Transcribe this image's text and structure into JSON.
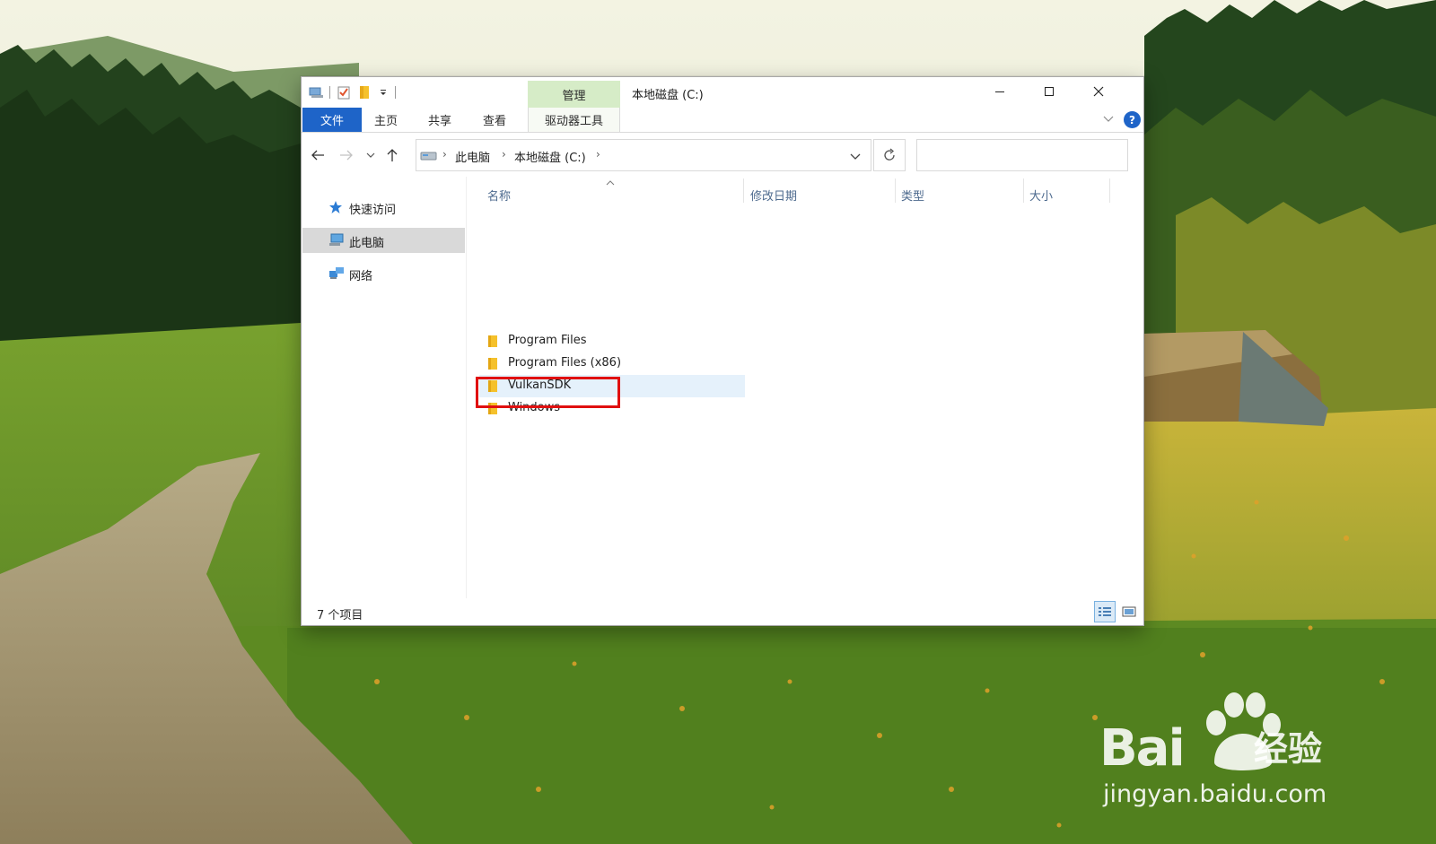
{
  "window": {
    "title": "本地磁盘 (C:)",
    "contextual_tab_group": "管理"
  },
  "ribbon": {
    "tabs": [
      {
        "label": "文件"
      },
      {
        "label": "主页"
      },
      {
        "label": "共享"
      },
      {
        "label": "查看"
      },
      {
        "label": "驱动器工具"
      }
    ],
    "help": "?"
  },
  "address": {
    "breadcrumbs": [
      "此电脑",
      "本地磁盘 (C:)"
    ],
    "search_value": ""
  },
  "navigation_pane": {
    "items": [
      {
        "label": "快速访问",
        "icon": "star-icon"
      },
      {
        "label": "此电脑",
        "icon": "computer-icon"
      },
      {
        "label": "网络",
        "icon": "network-icon"
      }
    ]
  },
  "columns": [
    {
      "label": "名称"
    },
    {
      "label": "修改日期"
    },
    {
      "label": "类型"
    },
    {
      "label": "大小"
    }
  ],
  "files": [
    {
      "name": "Program Files",
      "icon": "folder-icon"
    },
    {
      "name": "Program Files (x86)",
      "icon": "folder-icon"
    },
    {
      "name": "VulkanSDK",
      "icon": "folder-icon"
    },
    {
      "name": "Windows",
      "icon": "folder-icon"
    }
  ],
  "status": {
    "item_count": "7 个项目"
  },
  "watermark": {
    "brand": "Bai",
    "brand_tail": "经验",
    "url": "jingyan.baidu.com"
  },
  "colors": {
    "accent": "#1e64c8",
    "manage_tab": "#d6ecc7",
    "selection": "#d9d9d9",
    "highlight_row": "#e5f1fb",
    "annotation": "#e01010",
    "column_header_text": "#4d6a8e"
  }
}
